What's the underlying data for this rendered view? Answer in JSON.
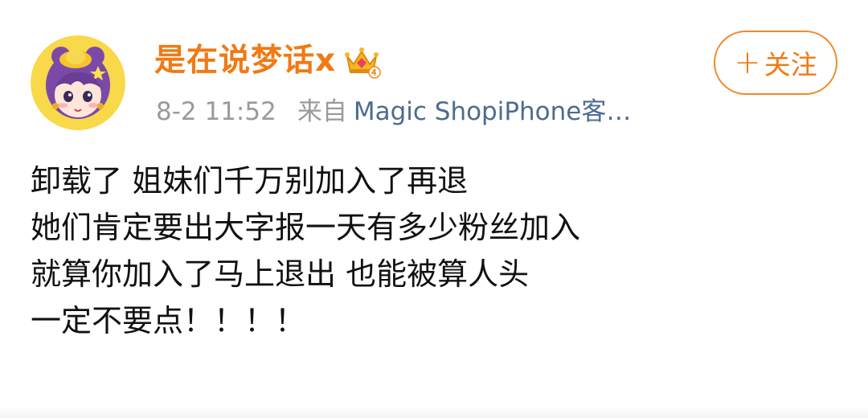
{
  "post": {
    "username": "是在说梦话x",
    "time": "8-2 11:52",
    "from_label": "来自",
    "source": "Magic ShopiPhone客…",
    "follow_label": "关注",
    "follow_plus": "+",
    "badge_icon": "crown-level-4-icon",
    "content_lines": [
      "卸载了 姐妹们千万别加入了再退",
      "她们肯定要出大字报一天有多少粉丝加入",
      "就算你加入了马上退出 也能被算人头",
      "一定不要点！！！！"
    ]
  },
  "colors": {
    "username": "#f07a14",
    "follow_border": "#f0892b",
    "source_link": "#4e6b8f",
    "meta_gray": "#9a9a9a",
    "text": "#111111"
  }
}
